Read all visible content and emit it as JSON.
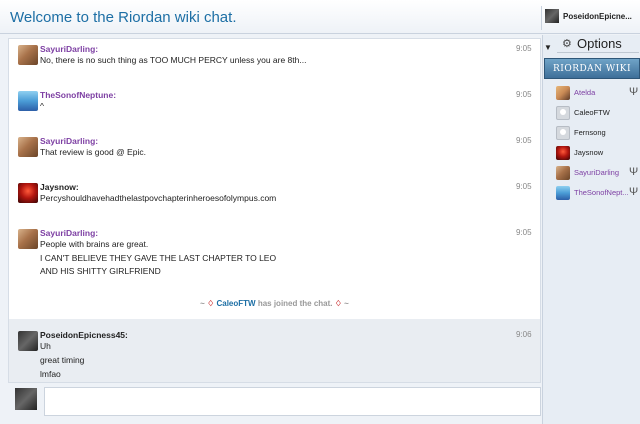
{
  "header": {
    "title": "Welcome to the Riordan wiki chat.",
    "current_user": "PoseidonEpicne..."
  },
  "messages": [
    {
      "user": "SayuriDarling:",
      "time": "9:05",
      "lines": [
        "No, there is no such thing as TOO MUCH PERCY unless you are 8th..."
      ]
    },
    {
      "user": "TheSonofNeptune:",
      "time": "9:05",
      "lines": [
        "^"
      ]
    },
    {
      "user": "SayuriDarling:",
      "time": "9:05",
      "lines": [
        "That review is good @ Epic."
      ]
    },
    {
      "user": "Jaysnow:",
      "time": "9:05",
      "lines": [
        "Percyshouldhavehadthelastpovchapterinheroesofolympus.com"
      ]
    },
    {
      "user": "SayuriDarling:",
      "time": "9:05",
      "lines": [
        "People with brains are great.",
        "I CAN'T BELIEVE THEY GAVE THE LAST CHAPTER TO LEO",
        "AND HIS SHITTY GIRLFRIEND"
      ]
    },
    {
      "user": "PoseidonEpicness45:",
      "time": "9:06",
      "lines": [
        "Uh",
        "great timing",
        "lmfao"
      ]
    }
  ],
  "inline_alert": {
    "prefix": "~",
    "user": "CaleoFTW",
    "text": "has joined the chat.",
    "suffix": "~"
  },
  "sidebar": {
    "options_label": "Options",
    "wiki_banner": "RIORDAN WIKI",
    "users": [
      {
        "name": "Atelda",
        "color": "#7d3fa3",
        "badge": "trident-icon"
      },
      {
        "name": "CaleoFTW",
        "color": "#222222",
        "badge": ""
      },
      {
        "name": "Fernsong",
        "color": "#222222",
        "badge": ""
      },
      {
        "name": "Jaysnow",
        "color": "#222222",
        "badge": ""
      },
      {
        "name": "SayuriDarling",
        "color": "#7d3fa3",
        "badge": "trident-icon"
      },
      {
        "name": "TheSonofNept...",
        "color": "#7d3fa3",
        "badge": "trident-icon"
      }
    ]
  },
  "colors": {
    "title_blue": "#1d6fa5",
    "moderator_purple": "#7d3fa3"
  }
}
